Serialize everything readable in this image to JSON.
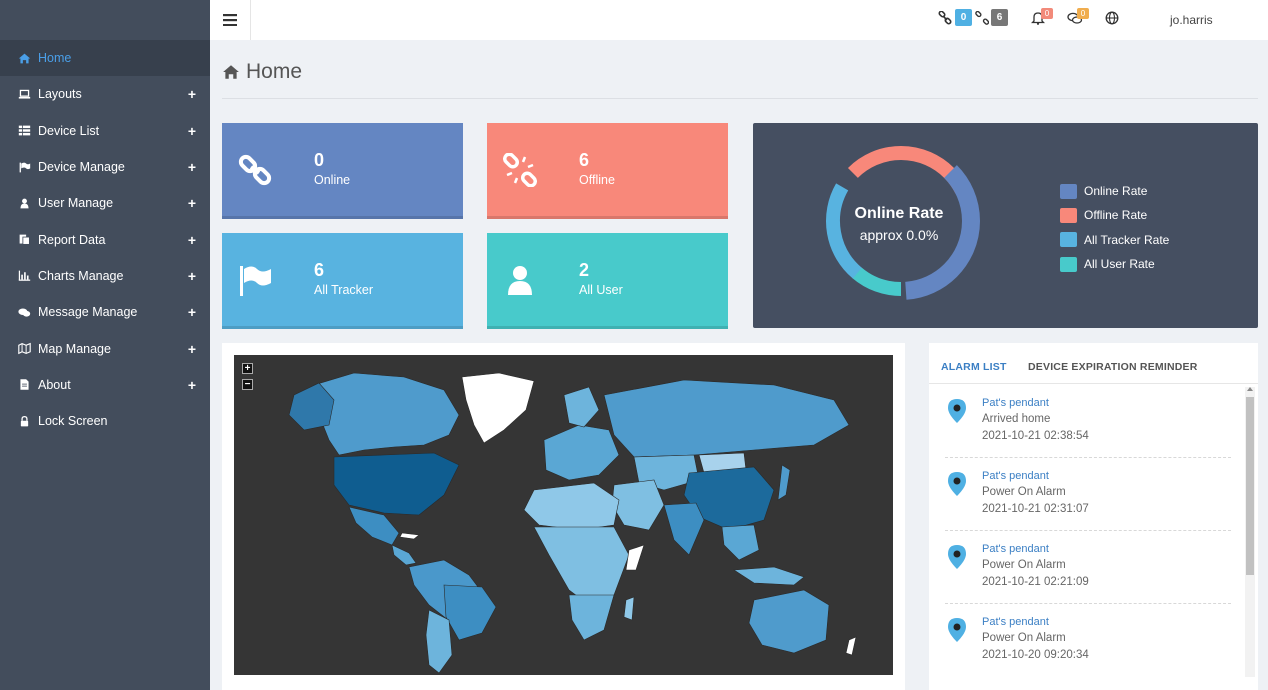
{
  "header": {
    "online_badge": "0",
    "offline_badge": "6",
    "notifications_badge": "0",
    "messages_badge": "0",
    "username": "jo.harris"
  },
  "sidebar": {
    "items": [
      {
        "label": "Home",
        "icon": "home-icon",
        "active": true
      },
      {
        "label": "Layouts",
        "icon": "laptop-icon",
        "expandable": true
      },
      {
        "label": "Device List",
        "icon": "list-icon",
        "expandable": true
      },
      {
        "label": "Device Manage",
        "icon": "flag-icon",
        "expandable": true
      },
      {
        "label": "User Manage",
        "icon": "user-icon",
        "expandable": true
      },
      {
        "label": "Report Data",
        "icon": "report-icon",
        "expandable": true
      },
      {
        "label": "Charts Manage",
        "icon": "bar-chart-icon",
        "expandable": true
      },
      {
        "label": "Message Manage",
        "icon": "comments-icon",
        "expandable": true
      },
      {
        "label": "Map Manage",
        "icon": "map-icon",
        "expandable": true
      },
      {
        "label": "About",
        "icon": "file-icon",
        "expandable": true
      },
      {
        "label": "Lock Screen",
        "icon": "lock-icon",
        "expandable": false
      }
    ],
    "expand_symbol": "+"
  },
  "page": {
    "title": "Home"
  },
  "cards": {
    "online": {
      "value": "0",
      "label": "Online"
    },
    "offline": {
      "value": "6",
      "label": "Offline"
    },
    "tracker": {
      "value": "6",
      "label": "All Tracker"
    },
    "user": {
      "value": "2",
      "label": "All User"
    }
  },
  "donut": {
    "title": "Online Rate",
    "subtitle": "approx 0.0%",
    "legend": [
      {
        "label": "Online Rate",
        "color": "#6486c2"
      },
      {
        "label": "Offline Rate",
        "color": "#f8887a"
      },
      {
        "label": "All Tracker Rate",
        "color": "#58b3e0"
      },
      {
        "label": "All User Rate",
        "color": "#48cacb"
      }
    ]
  },
  "map": {
    "zoom_in": "+",
    "zoom_out": "−"
  },
  "alarm": {
    "tabs": {
      "alarm_list": "ALARM LIST",
      "expiration": "DEVICE EXPIRATION REMINDER"
    },
    "items": [
      {
        "name": "Pat's pendant",
        "event": "Arrived home",
        "time": "2021-10-21 02:38:54"
      },
      {
        "name": "Pat's pendant",
        "event": "Power On Alarm",
        "time": "2021-10-21 02:31:07"
      },
      {
        "name": "Pat's pendant",
        "event": "Power On Alarm",
        "time": "2021-10-21 02:21:09"
      },
      {
        "name": "Pat's pendant",
        "event": "Power On Alarm",
        "time": "2021-10-20 09:20:34"
      }
    ]
  }
}
